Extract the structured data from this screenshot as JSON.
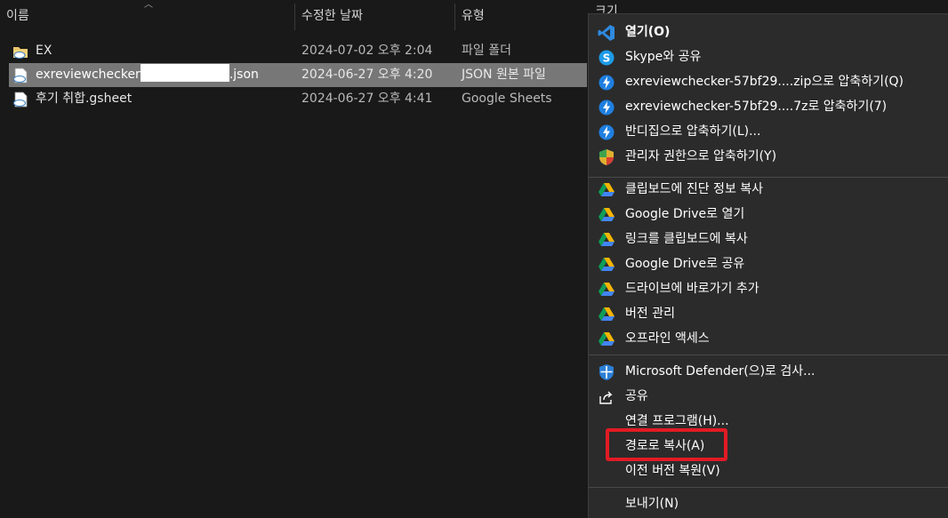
{
  "columns": {
    "name": "이름",
    "modified": "수정한 날짜",
    "type": "유형",
    "size": "크기"
  },
  "files": [
    {
      "name": "EX",
      "date": "2024-07-02 오후 2:04",
      "type": "파일 폴더",
      "icon": "folder-cloud-icon",
      "selected": false
    },
    {
      "name_prefix": "exreviewchecker",
      "name_suffix": ".json",
      "date": "2024-06-27 오후 4:20",
      "type": "JSON 원본 파일",
      "icon": "cloud-file-icon",
      "selected": true
    },
    {
      "name": "후기 취합.gsheet",
      "date": "2024-06-27 오후 4:41",
      "type": "Google Sheets",
      "icon": "cloud-file-icon",
      "selected": false
    }
  ],
  "context_menu": {
    "items": [
      {
        "label": "열기(O)",
        "icon": "vscode-icon"
      },
      {
        "label": "Skype와 공유",
        "icon": "skype-icon"
      },
      {
        "label": "exreviewchecker-57bf29....zip으로 압축하기(Q)",
        "icon": "bandizip-icon"
      },
      {
        "label": "exreviewchecker-57bf29....7z로 압축하기(7)",
        "icon": "bandizip-icon"
      },
      {
        "label": "반디집으로 압축하기(L)...",
        "icon": "bandizip-icon"
      },
      {
        "label": "관리자 권한으로 압축하기(Y)",
        "icon": "uac-shield-icon"
      },
      {
        "label": "클립보드에 진단 정보 복사",
        "icon": "google-drive-icon"
      },
      {
        "label": "Google Drive로 열기",
        "icon": "google-drive-icon"
      },
      {
        "label": "링크를 클립보드에 복사",
        "icon": "google-drive-icon"
      },
      {
        "label": "Google Drive로 공유",
        "icon": "google-drive-icon"
      },
      {
        "label": "드라이브에 바로가기 추가",
        "icon": "google-drive-icon"
      },
      {
        "label": "버전 관리",
        "icon": "google-drive-icon"
      },
      {
        "label": "오프라인 액세스",
        "icon": "google-drive-icon"
      },
      {
        "label": "Microsoft Defender(으)로 검사...",
        "icon": "defender-icon"
      },
      {
        "label": "공유",
        "icon": "share-icon"
      },
      {
        "label": "연결 프로그램(H)...",
        "icon": ""
      },
      {
        "label": "경로로 복사(A)",
        "icon": ""
      },
      {
        "label": "이전 버전 복원(V)",
        "icon": ""
      },
      {
        "label": "보내기(N)",
        "icon": ""
      }
    ]
  },
  "colors": {
    "background": "#191919",
    "selected_row": "#777777",
    "menu_background": "#2b2b2b",
    "highlight": "#e21b24"
  }
}
